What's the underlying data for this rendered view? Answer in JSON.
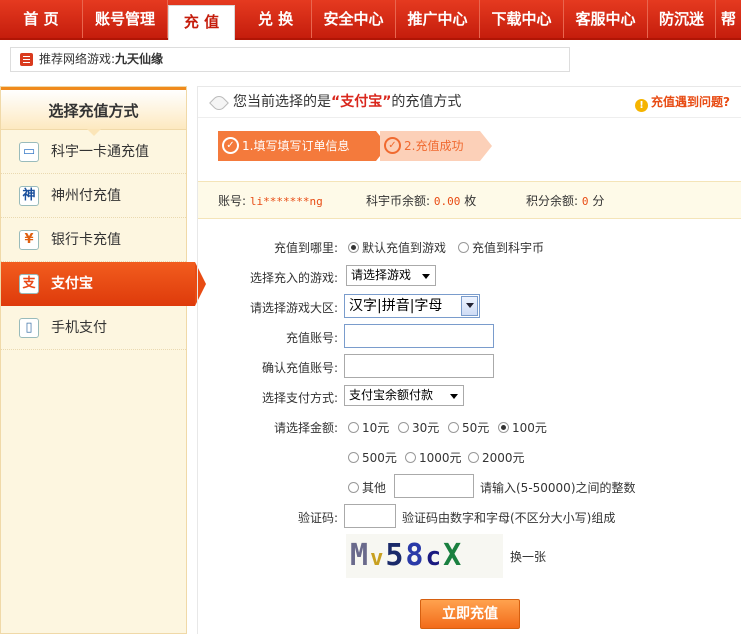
{
  "nav": [
    "首  页",
    "账号管理",
    "充  值",
    "兑  换",
    "安全中心",
    "推广中心",
    "下载中心",
    "客服中心",
    "防沉迷",
    "帮"
  ],
  "recommend": {
    "label": "推荐网络游戏:",
    "game": "九天仙缘"
  },
  "sidebar": {
    "title": "选择充值方式",
    "items": [
      {
        "label": "科宇一卡通充值",
        "icon": "card-icon"
      },
      {
        "label": "神州付充值",
        "icon": "shenzhoufu-icon"
      },
      {
        "label": "银行卡充值",
        "icon": "bank-icon"
      },
      {
        "label": "支付宝",
        "icon": "alipay-icon"
      },
      {
        "label": "手机支付",
        "icon": "phone-icon"
      }
    ]
  },
  "header": {
    "prefix": "您当前选择的是",
    "method": "“支付宝”",
    "suffix": "的充值方式",
    "help": "充值遇到问题?"
  },
  "steps": [
    "1.填写填写订单信息",
    "2.充值成功"
  ],
  "account": {
    "account_label": "账号:",
    "account_value": "li*******ng",
    "coin_label": "科宇币余额:",
    "coin_value": "0.00",
    "coin_unit": "枚",
    "points_label": "积分余额:",
    "points_value": "0",
    "points_unit": "分"
  },
  "form": {
    "target_label": "充值到哪里:",
    "target_options": [
      "默认充值到游戏",
      "充值到科宇币"
    ],
    "game_label": "选择充入的游戏:",
    "game_value": "请选择游戏",
    "server_label": "请选择游戏大区:",
    "server_value": "汉字|拼音|字母",
    "account_label": "充值账号:",
    "confirm_label": "确认充值账号:",
    "pay_label": "选择支付方式:",
    "pay_value": "支付宝余额付款",
    "amount_label": "请选择金额:",
    "amounts": [
      "10元",
      "30元",
      "50元",
      "100元",
      "500元",
      "1000元",
      "2000元"
    ],
    "other_label": "其他",
    "other_hint": "请输入(5-50000)之间的整数",
    "captcha_label": "验证码:",
    "captcha_hint": "验证码由数字和字母(不区分大小写)组成",
    "captcha_text": [
      "M",
      "v",
      "5",
      "8",
      "c",
      "X"
    ],
    "refresh": "换一张",
    "submit": "立即充值"
  }
}
